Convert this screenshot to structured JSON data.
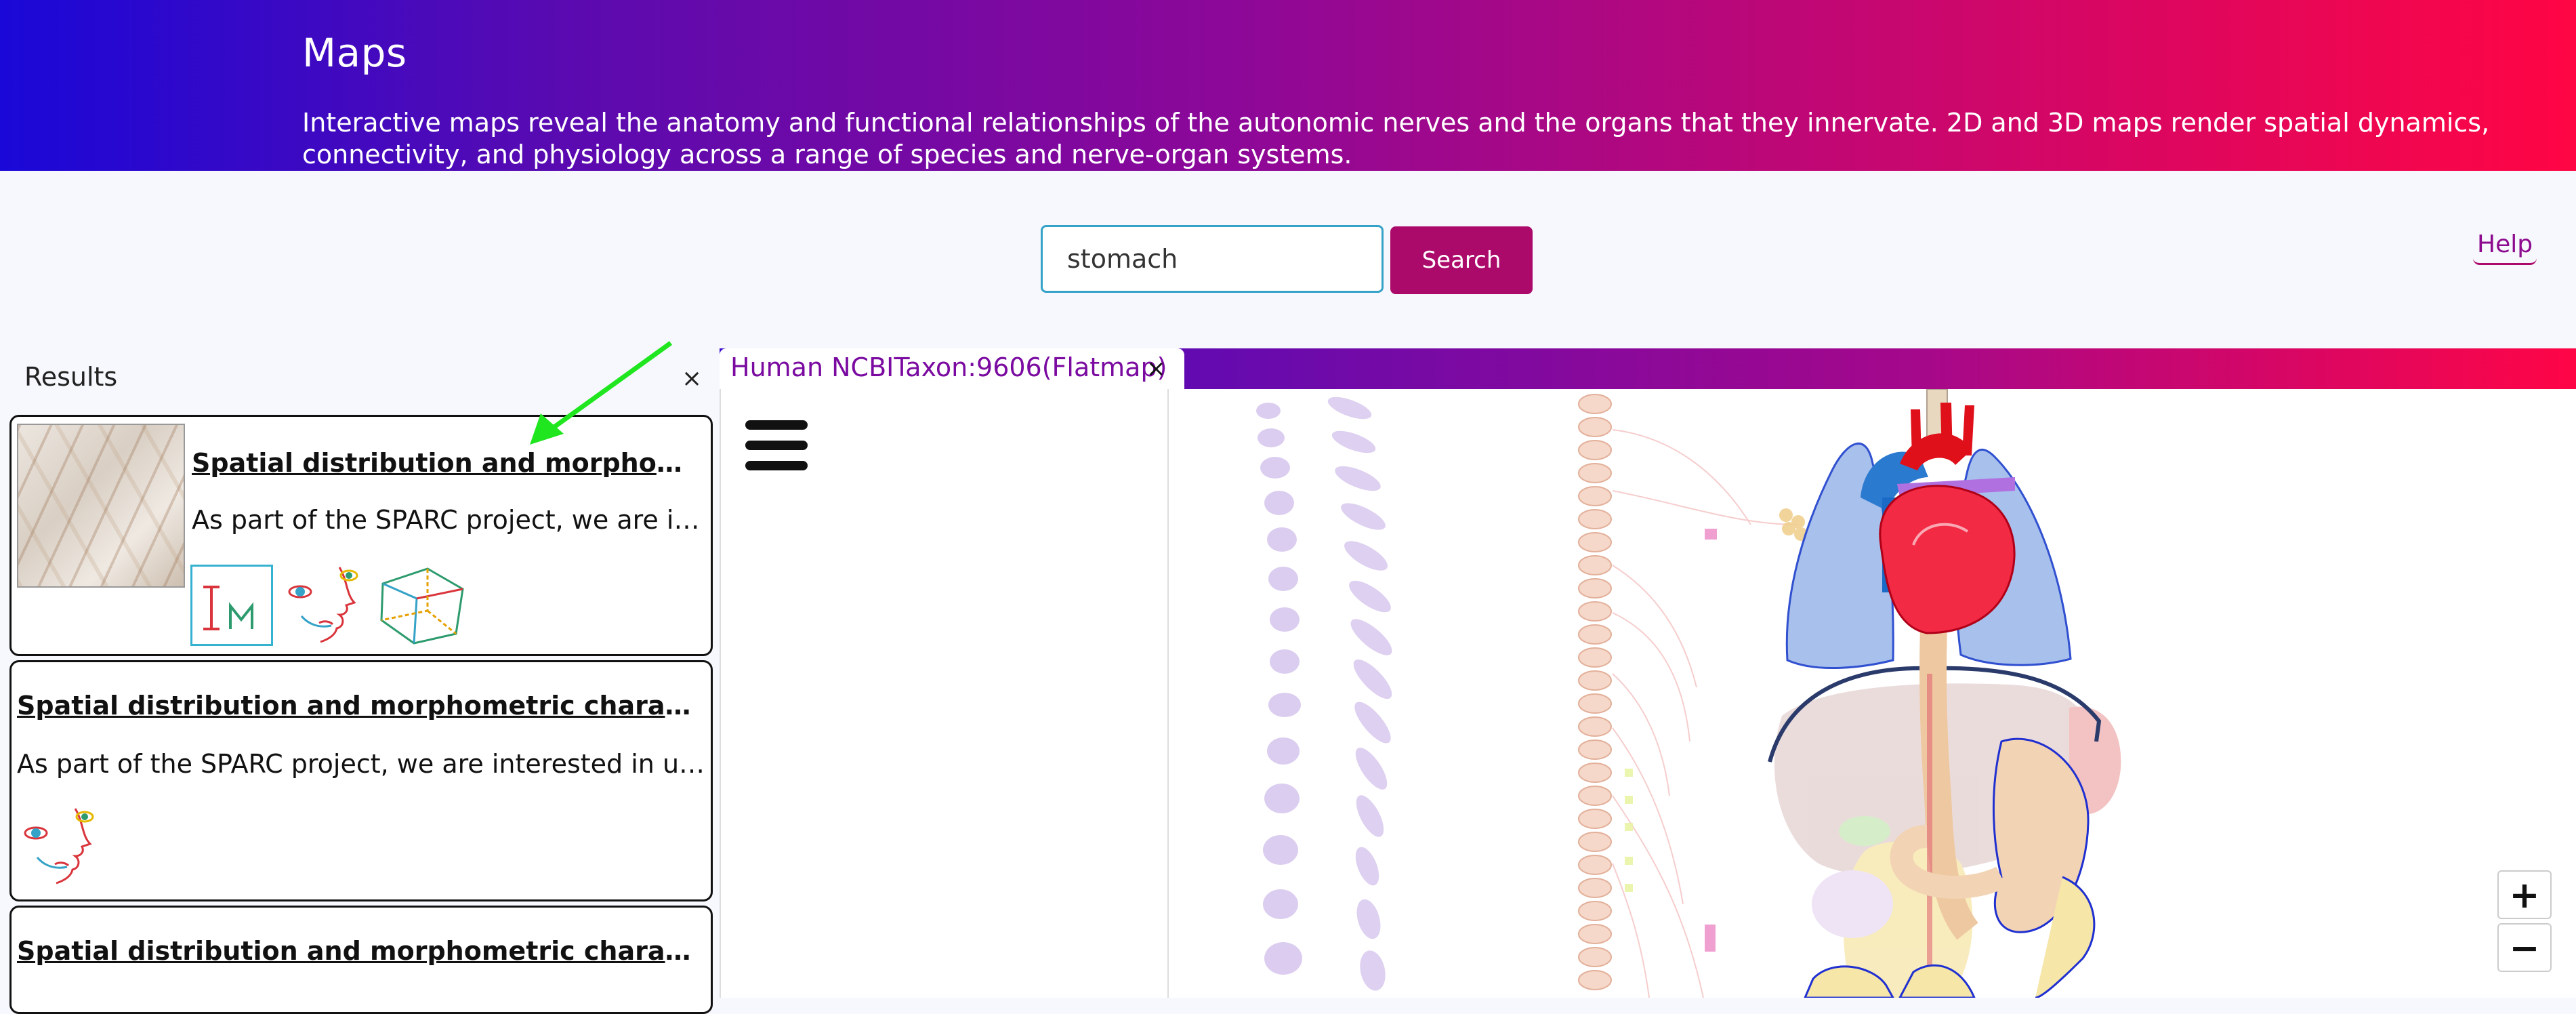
{
  "header": {
    "title": "Maps",
    "description": "Interactive maps reveal the anatomy and functional relationships of the autonomic nerves and the organs that they innervate. 2D and 3D maps render spatial dynamics, connectivity, and physiology across a range of species and nerve-organ systems."
  },
  "search": {
    "value": "stomach",
    "button_label": "Search"
  },
  "help_label": "Help",
  "results": {
    "title": "Results",
    "close_symbol": "×",
    "items": [
      {
        "title": "Spatial distribution and morphometric characterization of vagal afferents (intramuscular arrays (IMAs)) within the longitudinal and circular muscle layers of the rat stomach",
        "description": "As part of the SPARC project, we are interested in understanding the distribution of vagal afferents in the stomach",
        "icons": [
          "image-map-icon",
          "face-scaffold-icon",
          "cube-3d-icon"
        ]
      },
      {
        "title": "Spatial distribution and morphometric characterization of vagal afferents (intramuscular arrays (IMAs)) within the longitudinal and circular muscle layers of the rat stomach",
        "description": "As part of the SPARC project, we are interested in understanding the distribution of vagal afferents in the stomach",
        "icons": [
          "face-scaffold-icon"
        ]
      },
      {
        "title": "Spatial distribution and morphometric characterization of vagal afferents (intramuscular arrays (IMAs)) within the longitudinal and circular muscle layers of the rat stomach"
      }
    ]
  },
  "viewer": {
    "tab_label": "Human NCBITaxon:9606(Flatmap)",
    "tab_close_symbol": "×",
    "zoom_in": "+",
    "zoom_out": "−",
    "colors": {
      "header_start": "#1a08d8",
      "header_end": "#ff0544",
      "accent": "#ab0a6b",
      "tab_text": "#7a0aa0"
    }
  }
}
